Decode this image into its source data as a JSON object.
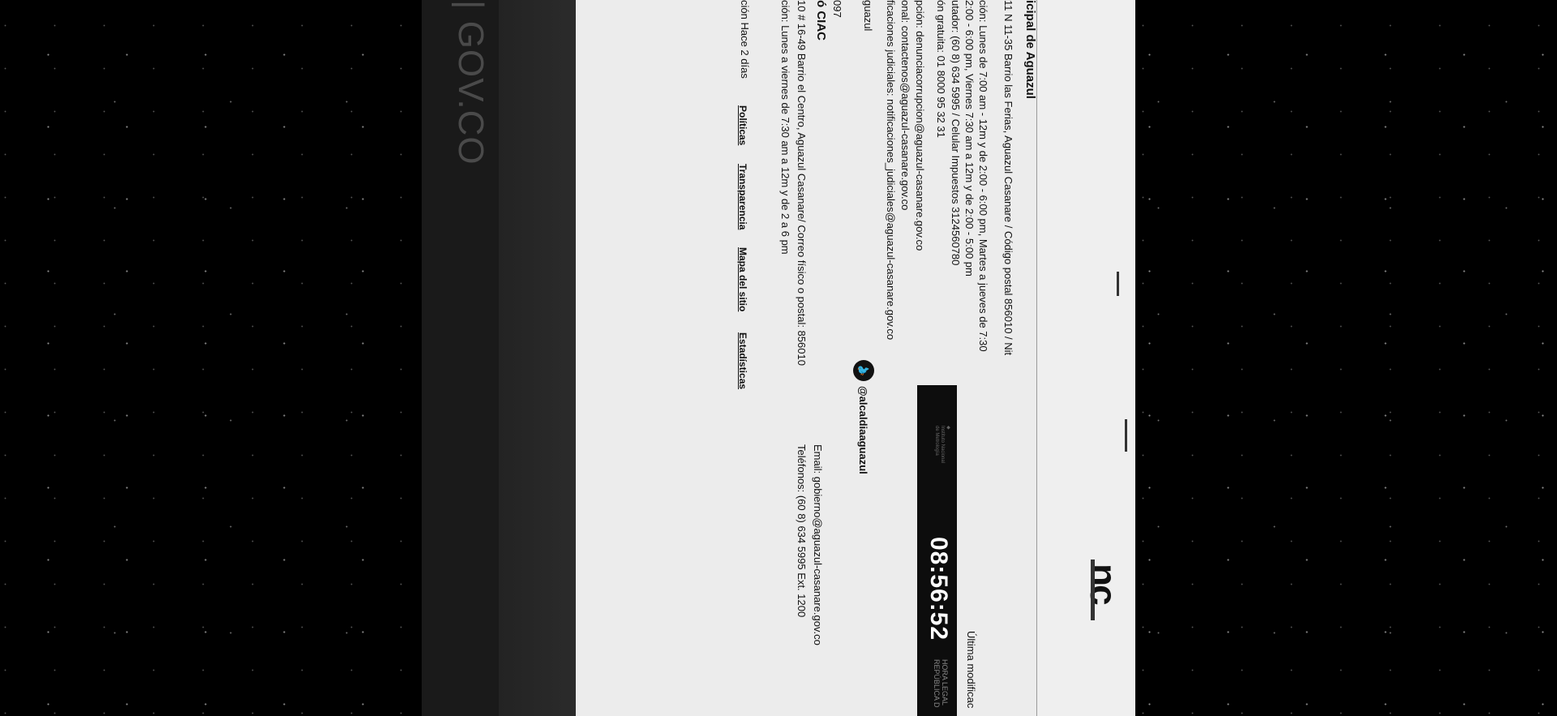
{
  "footer": {
    "title": "icipal de Aguazul",
    "address": "11 N 11-35 Barrio las Ferias, Aguazul Casanare / Código postal 856010 / Nit",
    "hours1": "ción: Lunes de 7:00 am - 12m y de 2:00 - 6:00 pm, Martes a jueves de 7:30",
    "hours2": "2:00 - 6:00 pm, Viernes 7:30 am a 12m y de 2:00 - 5:00 pm",
    "phone": "utador: (60 8) 634 5995 / Celular Impuestos 3124560780",
    "freeline": "ón gratuita: 01 8000 95 32 31",
    "corruption_email": "pción: denunciacorrupcion@aguazul-casanare.gov.co",
    "contact_email": "onal: contactenos@aguazul-casanare.gov.co",
    "judicial_email": "ficaciones judiciales: notificaciones_judiciales@aguazul-casanare.gov.co",
    "social_facebook": "guazul",
    "social_code": "097",
    "ciac_title": "ó CIAC",
    "ciac_address": "10 # 16-49 Barrio el Centro, Aguazul Casanare/ Correo físico o postal: 856010",
    "ciac_hours": "ción: Lunes a viernes de 7:30 am a 12m y de 2 a 6 pm",
    "ciac_email": "Email: gobierno@aguazul-casanare.gov.co",
    "ciac_phone": "Teléfonos: (60 8) 634 5995 Ext. 1200",
    "updated": "ción Hace 2 días",
    "last_modified": "Última modificac",
    "twitter_handle": "@alcaldiaaguazul",
    "links": [
      "Políticas",
      "Transparencia",
      "Mapa del sitio",
      "Estadísticas"
    ]
  },
  "clock": {
    "time": "08:56:52",
    "label1": "HORA LEGAL",
    "label2": "REPÚBLICA D"
  },
  "header_fragment": "nc",
  "gov_logo": "GOV.CO",
  "icons": {
    "twitter": "twitter-icon"
  }
}
